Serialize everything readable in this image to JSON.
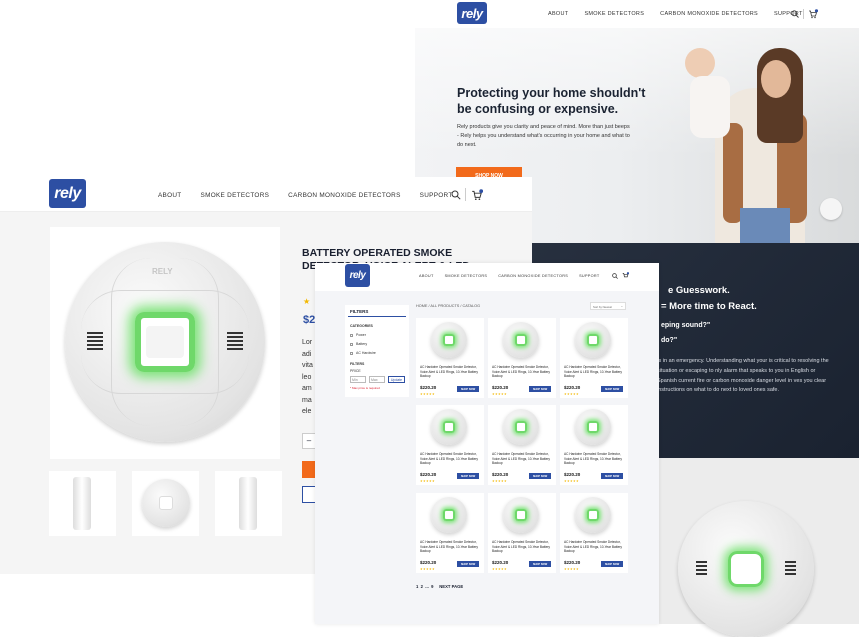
{
  "nav": {
    "about": "ABOUT",
    "smoke": "SMOKE DETECTORS",
    "co": "CARBON MONOXIDE DETECTORS",
    "support": "SUPPORT"
  },
  "brand": {
    "logo": "rely",
    "color": "#2d4fa3"
  },
  "home": {
    "headline": "Protecting your home shouldn't be confusing or expensive.",
    "body": "Rely products give you clarity and peace of mind. More than just beeps - Rely helps you understand what's occurring in your home and what to do next.",
    "cta": "SHOP NOW"
  },
  "about": {
    "line1": "e Guesswork.",
    "line2": "= More time to React.",
    "q1": "eping sound?\"",
    "q2": "do?\"",
    "body": "ts in an emergency. Understanding what your is critical to resolving the situation or escaping to nly alarm that speaks to you in English or Spanish current fire or carbon monoxide danger level in ves you clear instructions on what to do next to loved ones safe."
  },
  "product": {
    "title": "BATTERY OPERATED SMOKE DETECTOR, VOICE ALERT & LED",
    "price_fragment": "$2",
    "desc_lines": [
      "Lor",
      "adi",
      "vita",
      "leo",
      "am",
      "ma",
      "ele"
    ],
    "detector_label": "RELY"
  },
  "catalog": {
    "breadcrumb": "HOME / ALL PRODUCTS / CATALOG",
    "sort": "Sort by Newest",
    "filters_title": "FILTERS",
    "categories_title": "CATEGORIES",
    "categories": [
      "Power",
      "Battery",
      "AC Hardwire"
    ],
    "filters_sub": "FILTERS",
    "price_label": "PRICE",
    "min_ph": "Min",
    "max_ph": "Max",
    "update": "Update",
    "error": "* Max price is required",
    "card_title": "AC Hardwire Operated Smoke Detector, Voice Alert & LED Rings, 10-Year Battery Backup",
    "card_price": "$220.20",
    "card_stars": "★★★★★",
    "card_button": "SHOP NOW",
    "pagination": "1  2  ...  9     NEXT PAGE"
  }
}
